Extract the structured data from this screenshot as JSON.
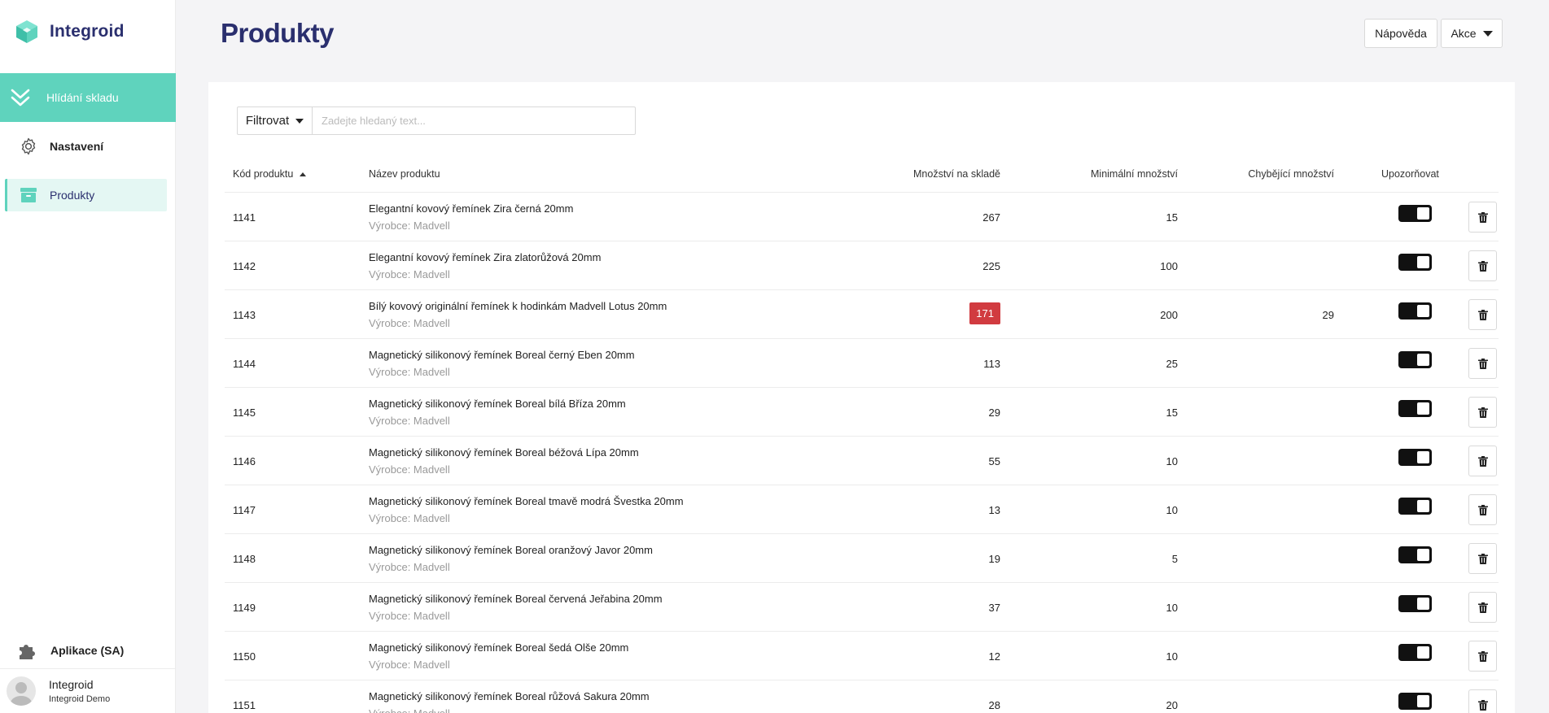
{
  "app": {
    "name": "Integroid",
    "brand_color": "#5fd3bd",
    "title_color": "#2a2f6e"
  },
  "sidebar": {
    "top_item": {
      "label": "Hlídání skladu",
      "icon": "chevrons-down-icon"
    },
    "items": [
      {
        "label": "Nastavení",
        "icon": "gear-icon"
      },
      {
        "label": "Produkty",
        "icon": "archive-box-icon",
        "active": true
      }
    ],
    "apps": {
      "label": "Aplikace (SA)",
      "icon": "puzzle-icon"
    },
    "user": {
      "name": "Integroid",
      "org": "Integroid Demo"
    }
  },
  "header": {
    "title": "Produkty",
    "help_label": "Nápověda",
    "actions_label": "Akce"
  },
  "filter": {
    "button_label": "Filtrovat",
    "placeholder": "Zadejte hledaný text..."
  },
  "table": {
    "columns": {
      "code": "Kód produktu",
      "name": "Název produktu",
      "stock": "Množství na skladě",
      "min": "Minimální množství",
      "missing": "Chybějící množství",
      "warn": "Upozorňovat"
    },
    "alert_color": "#d13b40",
    "rows": [
      {
        "code": "1141",
        "name": "Elegantní kovový řemínek Zira černá 20mm",
        "maker": "Výrobce: Madvell",
        "stock": "267",
        "min": "15",
        "missing": "",
        "alert": false,
        "warn": true
      },
      {
        "code": "1142",
        "name": "Elegantní kovový řemínek Zira zlatorůžová 20mm",
        "maker": "Výrobce: Madvell",
        "stock": "225",
        "min": "100",
        "missing": "",
        "alert": false,
        "warn": true
      },
      {
        "code": "1143",
        "name": "Bílý kovový originální řemínek k hodinkám Madvell Lotus 20mm",
        "maker": "Výrobce: Madvell",
        "stock": "171",
        "min": "200",
        "missing": "29",
        "alert": true,
        "warn": true
      },
      {
        "code": "1144",
        "name": "Magnetický silikonový řemínek Boreal černý Eben 20mm",
        "maker": "Výrobce: Madvell",
        "stock": "113",
        "min": "25",
        "missing": "",
        "alert": false,
        "warn": true
      },
      {
        "code": "1145",
        "name": "Magnetický silikonový řemínek Boreal bílá Bříza 20mm",
        "maker": "Výrobce: Madvell",
        "stock": "29",
        "min": "15",
        "missing": "",
        "alert": false,
        "warn": true
      },
      {
        "code": "1146",
        "name": "Magnetický silikonový řemínek Boreal béžová Lípa 20mm",
        "maker": "Výrobce: Madvell",
        "stock": "55",
        "min": "10",
        "missing": "",
        "alert": false,
        "warn": true
      },
      {
        "code": "1147",
        "name": "Magnetický silikonový řemínek Boreal tmavě modrá Švestka 20mm",
        "maker": "Výrobce: Madvell",
        "stock": "13",
        "min": "10",
        "missing": "",
        "alert": false,
        "warn": true
      },
      {
        "code": "1148",
        "name": "Magnetický silikonový řemínek Boreal oranžový Javor 20mm",
        "maker": "Výrobce: Madvell",
        "stock": "19",
        "min": "5",
        "missing": "",
        "alert": false,
        "warn": true
      },
      {
        "code": "1149",
        "name": "Magnetický silikonový řemínek Boreal červená Jeřabina 20mm",
        "maker": "Výrobce: Madvell",
        "stock": "37",
        "min": "10",
        "missing": "",
        "alert": false,
        "warn": true
      },
      {
        "code": "1150",
        "name": "Magnetický silikonový řemínek Boreal šedá Olše 20mm",
        "maker": "Výrobce: Madvell",
        "stock": "12",
        "min": "10",
        "missing": "",
        "alert": false,
        "warn": true
      },
      {
        "code": "1151",
        "name": "Magnetický silikonový řemínek Boreal růžová Sakura 20mm",
        "maker": "Výrobce: Madvell",
        "stock": "28",
        "min": "20",
        "missing": "",
        "alert": false,
        "warn": true
      }
    ]
  }
}
